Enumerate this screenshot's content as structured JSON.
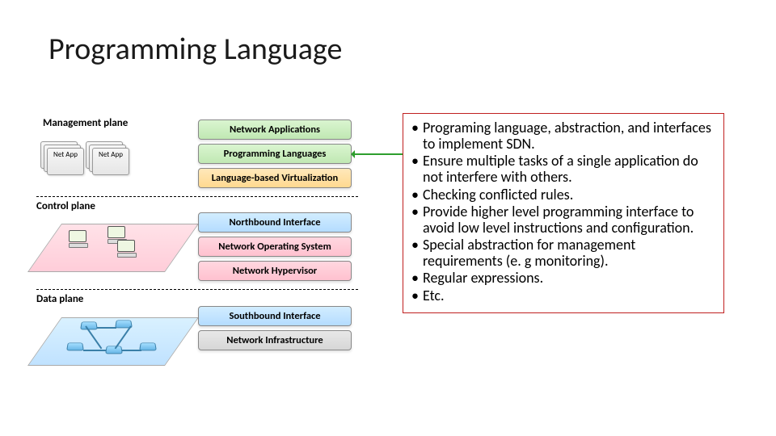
{
  "title": "Programming Language",
  "planes": {
    "management": "Management plane",
    "control": "Control plane",
    "data": "Data plane"
  },
  "app_label": "Net App",
  "layers": {
    "net_apps": "Network Applications",
    "prog_lang": "Programming Languages",
    "lang_virt": "Language-based Virtualization",
    "north": "Northbound Interface",
    "nos": "Network Operating System",
    "hyper": "Network Hypervisor",
    "south": "Southbound Interface",
    "infra": "Network Infrastructure"
  },
  "bullets": [
    "Programing language, abstraction, and interfaces to implement SDN.",
    "Ensure multiple tasks of a single application do not interfere with others.",
    "Checking conflicted rules.",
    "Provide higher level programming interface to avoid low level instructions and configuration.",
    "Special abstraction for management requirements (e. g monitoring).",
    "Regular expressions.",
    "Etc."
  ]
}
